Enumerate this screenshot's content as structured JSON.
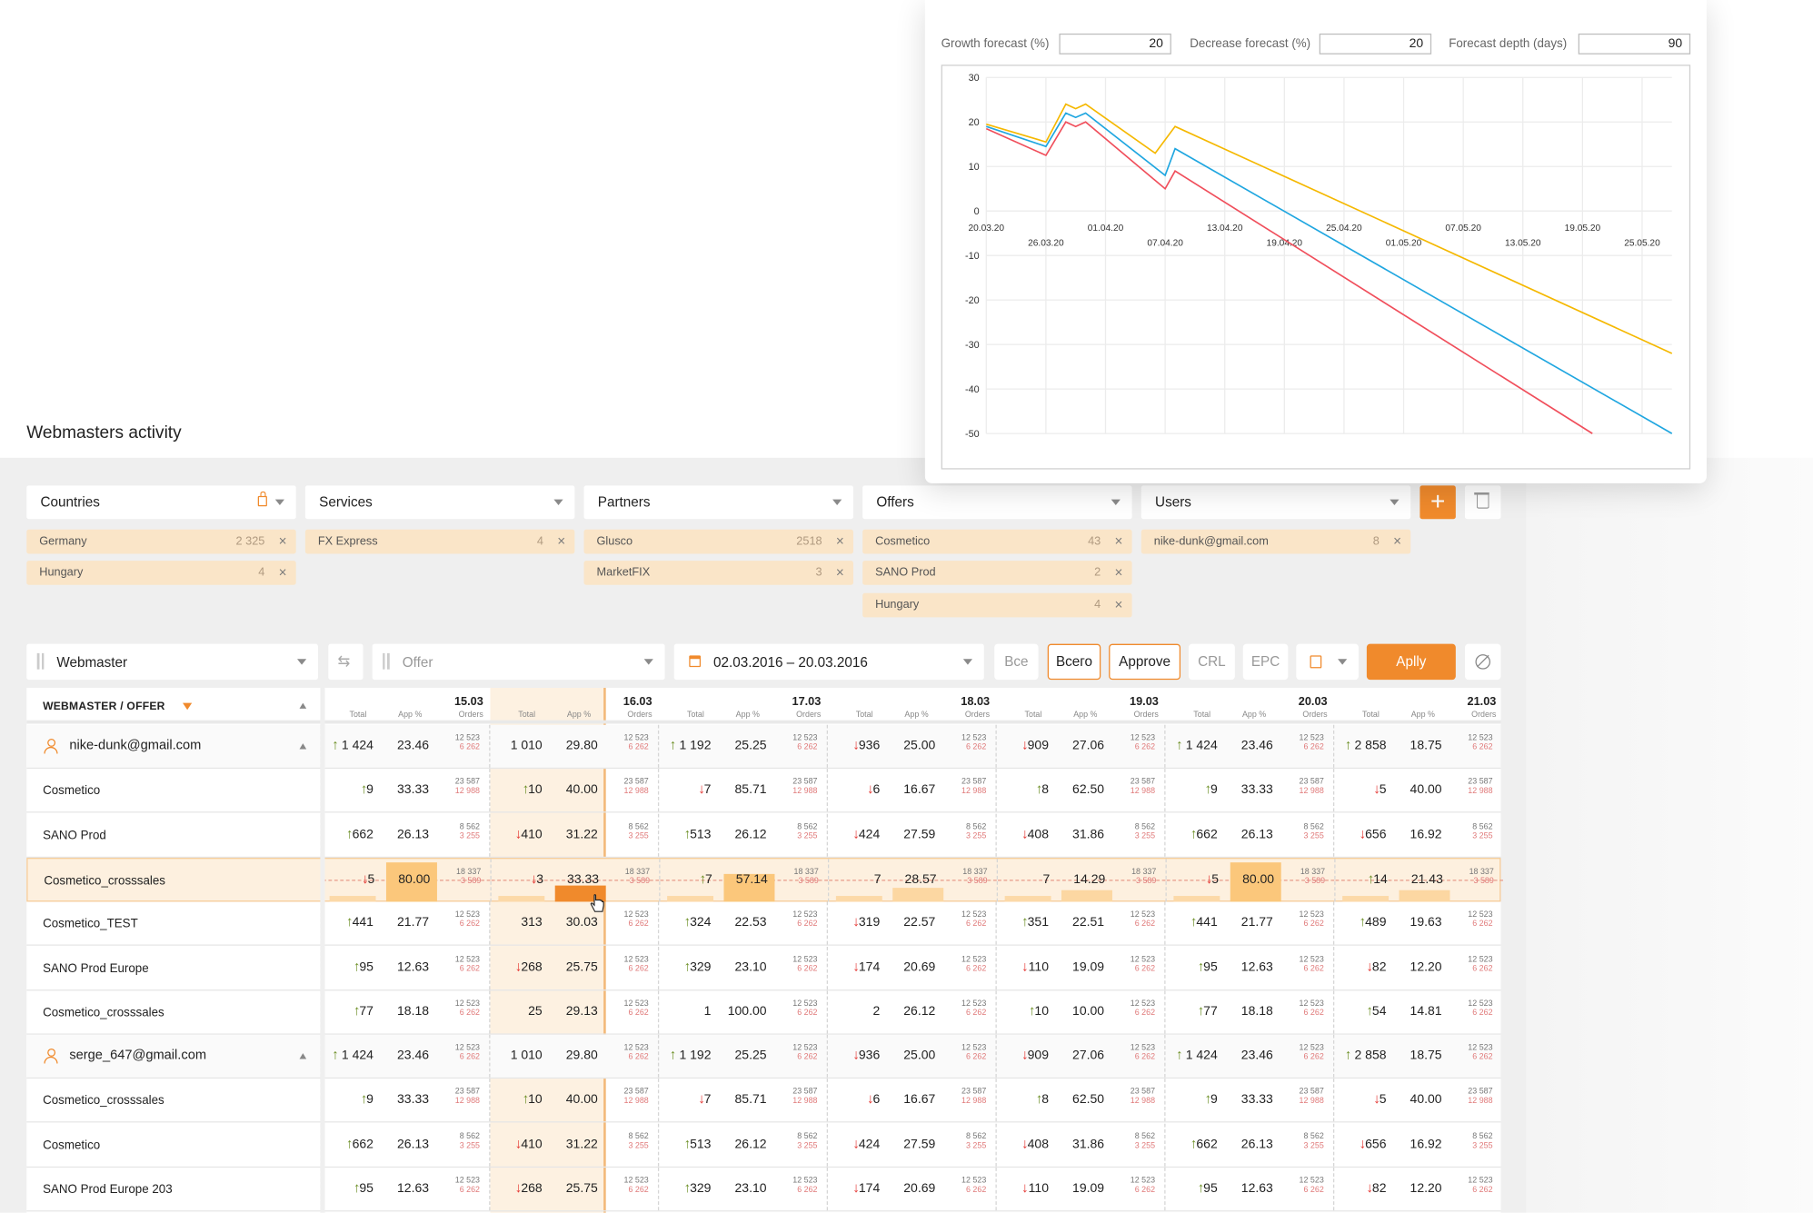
{
  "page": {
    "title": "Webmasters activity"
  },
  "forecast": {
    "growth_label": "Growth forecast (%)",
    "growth_value": "20",
    "decrease_label": "Decrease forecast (%)",
    "decrease_value": "20",
    "depth_label": "Forecast depth (days)",
    "depth_value": "90"
  },
  "chart_data": {
    "type": "line",
    "title": "",
    "ylim": [
      -50,
      30
    ],
    "y_ticks": [
      "30",
      "20",
      "10",
      "0",
      "-10",
      "-20",
      "-30",
      "-40",
      "-50"
    ],
    "x_ticks_upper": [
      "20.03.20",
      "01.04.20",
      "13.04.20",
      "25.04.20",
      "07.05.20",
      "19.05.20"
    ],
    "x_ticks_lower": [
      "26.03.20",
      "07.04.20",
      "19.04.20",
      "01.05.20",
      "13.05.20",
      "25.05.20"
    ],
    "x_range": [
      "20.03.20",
      "28.05.20"
    ],
    "series": [
      {
        "color": "#f5b800",
        "points": [
          [
            "20.03.20",
            19.5
          ],
          [
            "26.03.20",
            15.5
          ],
          [
            "28.03.20",
            24
          ],
          [
            "29.03.20",
            23
          ],
          [
            "30.03.20",
            24
          ],
          [
            "06.04.20",
            13
          ],
          [
            "08.04.20",
            19
          ],
          [
            "28.05.20",
            -32
          ]
        ]
      },
      {
        "color": "#1fa6e0",
        "points": [
          [
            "20.03.20",
            19
          ],
          [
            "26.03.20",
            14.5
          ],
          [
            "28.03.20",
            22
          ],
          [
            "29.03.20",
            21
          ],
          [
            "30.03.20",
            22
          ],
          [
            "07.04.20",
            8
          ],
          [
            "08.04.20",
            14
          ],
          [
            "28.05.20",
            -50
          ]
        ]
      },
      {
        "color": "#f04e5b",
        "points": [
          [
            "20.03.20",
            18.5
          ],
          [
            "26.03.20",
            12.5
          ],
          [
            "28.03.20",
            20
          ],
          [
            "29.03.20",
            19
          ],
          [
            "30.03.20",
            20
          ],
          [
            "07.04.20",
            5
          ],
          [
            "08.04.20",
            9
          ],
          [
            "20.05.20",
            -50
          ]
        ]
      }
    ]
  },
  "filters": {
    "countries": {
      "label": "Countries",
      "chips": [
        {
          "name": "Germany",
          "count": "2 325"
        },
        {
          "name": "Hungary",
          "count": "4"
        }
      ]
    },
    "services": {
      "label": "Services",
      "chips": [
        {
          "name": "FX Express",
          "count": "4"
        }
      ]
    },
    "partners": {
      "label": "Partners",
      "chips": [
        {
          "name": "Glusco",
          "count": "2518"
        },
        {
          "name": "MarketFIX",
          "count": "3"
        }
      ]
    },
    "offers": {
      "label": "Offers",
      "chips": [
        {
          "name": "Cosmetico",
          "count": "43"
        },
        {
          "name": "SANO Prod",
          "count": "2"
        },
        {
          "name": "Hungary",
          "count": "4"
        }
      ]
    },
    "users": {
      "label": "Users",
      "chips": [
        {
          "name": "nike-dunk@gmail.com",
          "count": "8"
        }
      ]
    },
    "add_label": "+",
    "remove_chip": "×"
  },
  "toolbar": {
    "webmaster": "Webmaster",
    "offer_placeholder": "Offer",
    "date_range": "02.03.2016 – 20.03.2016",
    "btn_all_1": "Все",
    "btn_all_2": "Всего",
    "btn_approve": "Approve",
    "btn_crl": "CRL",
    "btn_epc": "EPC",
    "apply": "Aplly"
  },
  "table": {
    "header": "WEBMASTER / OFFER",
    "sub_total": "Total",
    "sub_app": "App %",
    "sub_orders": "Orders",
    "days": [
      "15.03",
      "16.03",
      "17.03",
      "18.03",
      "19.03",
      "20.03",
      "21.03"
    ],
    "rows": [
      {
        "label": "nike-dunk@gmail.com",
        "group": true,
        "cells": [
          [
            "up",
            "1 424",
            "23.46",
            "12 523",
            "6 262"
          ],
          [
            "",
            "1 010",
            "29.80",
            "12 523",
            "6 262"
          ],
          [
            "up",
            "1 192",
            "25.25",
            "12 523",
            "6 262"
          ],
          [
            "down",
            "936",
            "25.00",
            "12 523",
            "6 262"
          ],
          [
            "down",
            "909",
            "27.06",
            "12 523",
            "6 262"
          ],
          [
            "up",
            "1 424",
            "23.46",
            "12 523",
            "6 262"
          ],
          [
            "up",
            "2 858",
            "18.75",
            "12 523",
            "6 262"
          ]
        ]
      },
      {
        "label": "Cosmetico",
        "cells": [
          [
            "up",
            "9",
            "33.33",
            "23 587",
            "12 988"
          ],
          [
            "up",
            "10",
            "40.00",
            "23 587",
            "12 988"
          ],
          [
            "down",
            "7",
            "85.71",
            "23 587",
            "12 988"
          ],
          [
            "down",
            "6",
            "16.67",
            "23 587",
            "12 988"
          ],
          [
            "up",
            "8",
            "62.50",
            "23 587",
            "12 988"
          ],
          [
            "up",
            "9",
            "33.33",
            "23 587",
            "12 988"
          ],
          [
            "down",
            "5",
            "40.00",
            "23 587",
            "12 988"
          ]
        ]
      },
      {
        "label": "SANO Prod",
        "cells": [
          [
            "up",
            "662",
            "26.13",
            "8 562",
            "3 255"
          ],
          [
            "down",
            "410",
            "31.22",
            "8 562",
            "3 255"
          ],
          [
            "up",
            "513",
            "26.12",
            "8 562",
            "3 255"
          ],
          [
            "down",
            "424",
            "27.59",
            "8 562",
            "3 255"
          ],
          [
            "down",
            "408",
            "31.86",
            "8 562",
            "3 255"
          ],
          [
            "up",
            "662",
            "26.13",
            "8 562",
            "3 255"
          ],
          [
            "down",
            "656",
            "16.92",
            "8 562",
            "3 255"
          ]
        ]
      },
      {
        "label": "Cosmetico_crosssales",
        "highlight": true,
        "cells": [
          [
            "down",
            "5",
            "80.00",
            "18 337",
            "3 589"
          ],
          [
            "down",
            "3",
            "33.33",
            "18 337",
            "3 589"
          ],
          [
            "up",
            "7",
            "57.14",
            "18 337",
            "3 589"
          ],
          [
            "",
            "7",
            "28.57",
            "18 337",
            "3 589"
          ],
          [
            "",
            "7",
            "14.29",
            "18 337",
            "3 589"
          ],
          [
            "down",
            "5",
            "80.00",
            "18 337",
            "3 589"
          ],
          [
            "up",
            "14",
            "21.43",
            "18 337",
            "3 589"
          ]
        ]
      },
      {
        "label": "Cosmetico_TEST",
        "cells": [
          [
            "up",
            "441",
            "21.77",
            "12 523",
            "6 262"
          ],
          [
            "",
            "313",
            "30.03",
            "12 523",
            "6 262"
          ],
          [
            "up",
            "324",
            "22.53",
            "12 523",
            "6 262"
          ],
          [
            "down",
            "319",
            "22.57",
            "12 523",
            "6 262"
          ],
          [
            "up",
            "351",
            "22.51",
            "12 523",
            "6 262"
          ],
          [
            "up",
            "441",
            "21.77",
            "12 523",
            "6 262"
          ],
          [
            "up",
            "489",
            "19.63",
            "12 523",
            "6 262"
          ]
        ]
      },
      {
        "label": "SANO Prod Europe",
        "cells": [
          [
            "up",
            "95",
            "12.63",
            "12 523",
            "6 262"
          ],
          [
            "down",
            "268",
            "25.75",
            "12 523",
            "6 262"
          ],
          [
            "up",
            "329",
            "23.10",
            "12 523",
            "6 262"
          ],
          [
            "down",
            "174",
            "20.69",
            "12 523",
            "6 262"
          ],
          [
            "down",
            "110",
            "19.09",
            "12 523",
            "6 262"
          ],
          [
            "up",
            "95",
            "12.63",
            "12 523",
            "6 262"
          ],
          [
            "down",
            "82",
            "12.20",
            "12 523",
            "6 262"
          ]
        ]
      },
      {
        "label": "Cosmetico_crosssales",
        "cells": [
          [
            "up",
            "77",
            "18.18",
            "12 523",
            "6 262"
          ],
          [
            "",
            "25",
            "29.13",
            "12 523",
            "6 262"
          ],
          [
            "",
            "1",
            "100.00",
            "12 523",
            "6 262"
          ],
          [
            "",
            "2",
            "26.12",
            "12 523",
            "6 262"
          ],
          [
            "up",
            "10",
            "10.00",
            "12 523",
            "6 262"
          ],
          [
            "up",
            "77",
            "18.18",
            "12 523",
            "6 262"
          ],
          [
            "up",
            "54",
            "14.81",
            "12 523",
            "6 262"
          ]
        ]
      },
      {
        "label": "serge_647@gmail.com",
        "group": true,
        "cells": [
          [
            "up",
            "1 424",
            "23.46",
            "12 523",
            "6 262"
          ],
          [
            "",
            "1 010",
            "29.80",
            "12 523",
            "6 262"
          ],
          [
            "up",
            "1 192",
            "25.25",
            "12 523",
            "6 262"
          ],
          [
            "down",
            "936",
            "25.00",
            "12 523",
            "6 262"
          ],
          [
            "down",
            "909",
            "27.06",
            "12 523",
            "6 262"
          ],
          [
            "up",
            "1 424",
            "23.46",
            "12 523",
            "6 262"
          ],
          [
            "up",
            "2 858",
            "18.75",
            "12 523",
            "6 262"
          ]
        ]
      },
      {
        "label": "Cosmetico_crosssales",
        "cells": [
          [
            "up",
            "9",
            "33.33",
            "23 587",
            "12 988"
          ],
          [
            "up",
            "10",
            "40.00",
            "23 587",
            "12 988"
          ],
          [
            "down",
            "7",
            "85.71",
            "23 587",
            "12 988"
          ],
          [
            "down",
            "6",
            "16.67",
            "23 587",
            "12 988"
          ],
          [
            "up",
            "8",
            "62.50",
            "23 587",
            "12 988"
          ],
          [
            "up",
            "9",
            "33.33",
            "23 587",
            "12 988"
          ],
          [
            "down",
            "5",
            "40.00",
            "23 587",
            "12 988"
          ]
        ]
      },
      {
        "label": "Cosmetico",
        "cells": [
          [
            "up",
            "662",
            "26.13",
            "8 562",
            "3 255"
          ],
          [
            "down",
            "410",
            "31.22",
            "8 562",
            "3 255"
          ],
          [
            "up",
            "513",
            "26.12",
            "8 562",
            "3 255"
          ],
          [
            "down",
            "424",
            "27.59",
            "8 562",
            "3 255"
          ],
          [
            "down",
            "408",
            "31.86",
            "8 562",
            "3 255"
          ],
          [
            "up",
            "662",
            "26.13",
            "8 562",
            "3 255"
          ],
          [
            "down",
            "656",
            "16.92",
            "8 562",
            "3 255"
          ]
        ]
      },
      {
        "label": "SANO Prod Europe 203",
        "cells": [
          [
            "up",
            "95",
            "12.63",
            "12 523",
            "6 262"
          ],
          [
            "down",
            "268",
            "25.75",
            "12 523",
            "6 262"
          ],
          [
            "up",
            "329",
            "23.10",
            "12 523",
            "6 262"
          ],
          [
            "down",
            "174",
            "20.69",
            "12 523",
            "6 262"
          ],
          [
            "down",
            "110",
            "19.09",
            "12 523",
            "6 262"
          ],
          [
            "up",
            "95",
            "12.63",
            "12 523",
            "6 262"
          ],
          [
            "down",
            "82",
            "12.20",
            "12 523",
            "6 262"
          ]
        ]
      }
    ]
  }
}
